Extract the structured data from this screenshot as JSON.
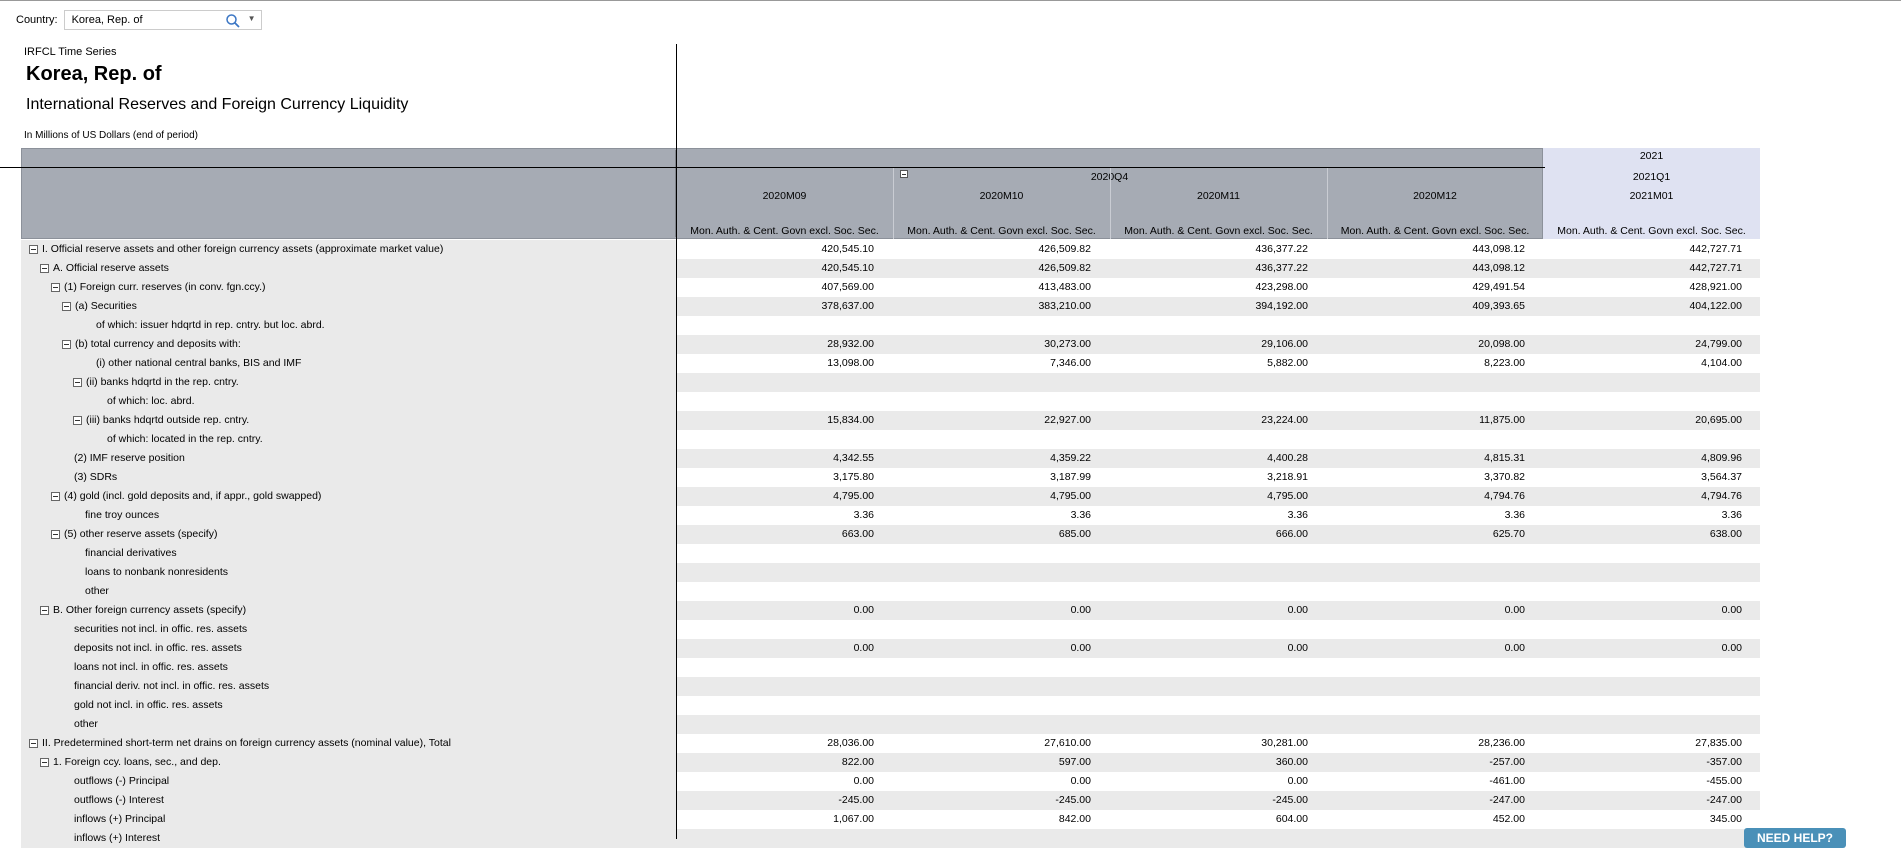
{
  "country_selector": {
    "label": "Country:",
    "value": "Korea, Rep. of",
    "icons": {
      "search": "search-icon",
      "dropdown": "chevron-down-icon"
    }
  },
  "report": {
    "series_label": "IRFCL Time Series",
    "country": "Korea, Rep. of",
    "title": "International Reserves and Foreign Currency Liquidity",
    "units": "In Millions of US Dollars (end of period)"
  },
  "header": {
    "year_2021": "2021",
    "quarter_2020q4": "2020Q4",
    "quarter_2021q1": "2021Q1",
    "months": [
      "2020M09",
      "2020M10",
      "2020M11",
      "2020M12",
      "2021M01"
    ],
    "sector": "Mon. Auth. & Cent. Govn excl. Soc. Sec."
  },
  "rows": [
    {
      "label": "I. Official reserve assets and other foreign currency assets (approximate market value)",
      "indent": 0,
      "toggle": true,
      "values": [
        "420,545.10",
        "426,509.82",
        "436,377.22",
        "443,098.12",
        "442,727.71"
      ]
    },
    {
      "label": "A. Official reserve assets",
      "indent": 1,
      "toggle": true,
      "values": [
        "420,545.10",
        "426,509.82",
        "436,377.22",
        "443,098.12",
        "442,727.71"
      ]
    },
    {
      "label": "(1) Foreign curr. reserves (in conv. fgn.ccy.)",
      "indent": 2,
      "toggle": true,
      "values": [
        "407,569.00",
        "413,483.00",
        "423,298.00",
        "429,491.54",
        "428,921.00"
      ]
    },
    {
      "label": "(a) Securities",
      "indent": 3,
      "toggle": true,
      "values": [
        "378,637.00",
        "383,210.00",
        "394,192.00",
        "409,393.65",
        "404,122.00"
      ]
    },
    {
      "label": "of which: issuer hdqrtd in rep. cntry. but loc. abrd.",
      "indent": 5,
      "toggle": false,
      "values": [
        "",
        "",
        "",
        "",
        ""
      ]
    },
    {
      "label": "(b) total currency and deposits with:",
      "indent": 3,
      "toggle": true,
      "values": [
        "28,932.00",
        "30,273.00",
        "29,106.00",
        "20,098.00",
        "24,799.00"
      ]
    },
    {
      "label": "(i) other national central banks, BIS and IMF",
      "indent": 5,
      "toggle": false,
      "values": [
        "13,098.00",
        "7,346.00",
        "5,882.00",
        "8,223.00",
        "4,104.00"
      ]
    },
    {
      "label": "(ii) banks hdqrtd in the rep. cntry.",
      "indent": 4,
      "toggle": true,
      "values": [
        "",
        "",
        "",
        "",
        ""
      ]
    },
    {
      "label": "of which: loc. abrd.",
      "indent": 6,
      "toggle": false,
      "values": [
        "",
        "",
        "",
        "",
        ""
      ]
    },
    {
      "label": "(iii) banks hdqrtd outside rep. cntry.",
      "indent": 4,
      "toggle": true,
      "values": [
        "15,834.00",
        "22,927.00",
        "23,224.00",
        "11,875.00",
        "20,695.00"
      ]
    },
    {
      "label": "of which: located in the rep. cntry.",
      "indent": 6,
      "toggle": false,
      "values": [
        "",
        "",
        "",
        "",
        ""
      ]
    },
    {
      "label": "(2) IMF reserve position",
      "indent": 3,
      "toggle": false,
      "values": [
        "4,342.55",
        "4,359.22",
        "4,400.28",
        "4,815.31",
        "4,809.96"
      ]
    },
    {
      "label": "(3) SDRs",
      "indent": 3,
      "toggle": false,
      "values": [
        "3,175.80",
        "3,187.99",
        "3,218.91",
        "3,370.82",
        "3,564.37"
      ]
    },
    {
      "label": "(4) gold (incl. gold deposits and, if appr., gold swapped)",
      "indent": 2,
      "toggle": true,
      "values": [
        "4,795.00",
        "4,795.00",
        "4,795.00",
        "4,794.76",
        "4,794.76"
      ]
    },
    {
      "label": "fine troy ounces",
      "indent": 4,
      "toggle": false,
      "values": [
        "3.36",
        "3.36",
        "3.36",
        "3.36",
        "3.36"
      ]
    },
    {
      "label": "(5) other reserve assets (specify)",
      "indent": 2,
      "toggle": true,
      "values": [
        "663.00",
        "685.00",
        "666.00",
        "625.70",
        "638.00"
      ]
    },
    {
      "label": "financial derivatives",
      "indent": 4,
      "toggle": false,
      "values": [
        "",
        "",
        "",
        "",
        ""
      ]
    },
    {
      "label": "loans to nonbank nonresidents",
      "indent": 4,
      "toggle": false,
      "values": [
        "",
        "",
        "",
        "",
        ""
      ]
    },
    {
      "label": "other",
      "indent": 4,
      "toggle": false,
      "values": [
        "",
        "",
        "",
        "",
        ""
      ]
    },
    {
      "label": "B. Other foreign currency assets (specify)",
      "indent": 1,
      "toggle": true,
      "values": [
        "0.00",
        "0.00",
        "0.00",
        "0.00",
        "0.00"
      ]
    },
    {
      "label": "securities not incl. in offic. res. assets",
      "indent": 3,
      "toggle": false,
      "values": [
        "",
        "",
        "",
        "",
        ""
      ]
    },
    {
      "label": "deposits not incl. in offic. res. assets",
      "indent": 3,
      "toggle": false,
      "values": [
        "0.00",
        "0.00",
        "0.00",
        "0.00",
        "0.00"
      ]
    },
    {
      "label": "loans not incl. in offic. res. assets",
      "indent": 3,
      "toggle": false,
      "values": [
        "",
        "",
        "",
        "",
        ""
      ]
    },
    {
      "label": "financial deriv. not incl. in offic. res. assets",
      "indent": 3,
      "toggle": false,
      "values": [
        "",
        "",
        "",
        "",
        ""
      ]
    },
    {
      "label": "gold not incl. in offic. res. assets",
      "indent": 3,
      "toggle": false,
      "values": [
        "",
        "",
        "",
        "",
        ""
      ]
    },
    {
      "label": "other",
      "indent": 3,
      "toggle": false,
      "values": [
        "",
        "",
        "",
        "",
        ""
      ]
    },
    {
      "label": "II. Predetermined short-term net drains on foreign currency assets (nominal value), Total",
      "indent": 0,
      "toggle": true,
      "values": [
        "28,036.00",
        "27,610.00",
        "30,281.00",
        "28,236.00",
        "27,835.00"
      ]
    },
    {
      "label": "1. Foreign ccy. loans, sec., and dep.",
      "indent": 1,
      "toggle": true,
      "values": [
        "822.00",
        "597.00",
        "360.00",
        "-257.00",
        "-357.00"
      ]
    },
    {
      "label": "outflows (-) Principal",
      "indent": 3,
      "toggle": false,
      "values": [
        "0.00",
        "0.00",
        "0.00",
        "-461.00",
        "-455.00"
      ]
    },
    {
      "label": "outflows (-) Interest",
      "indent": 3,
      "toggle": false,
      "values": [
        "-245.00",
        "-245.00",
        "-245.00",
        "-247.00",
        "-247.00"
      ]
    },
    {
      "label": "inflows (+) Principal",
      "indent": 3,
      "toggle": false,
      "values": [
        "1,067.00",
        "842.00",
        "604.00",
        "452.00",
        "345.00"
      ]
    },
    {
      "label": "inflows (+) Interest",
      "indent": 3,
      "toggle": false,
      "values": [
        "",
        "",
        "",
        "",
        ""
      ]
    }
  ],
  "help_button": "NEED HELP?"
}
